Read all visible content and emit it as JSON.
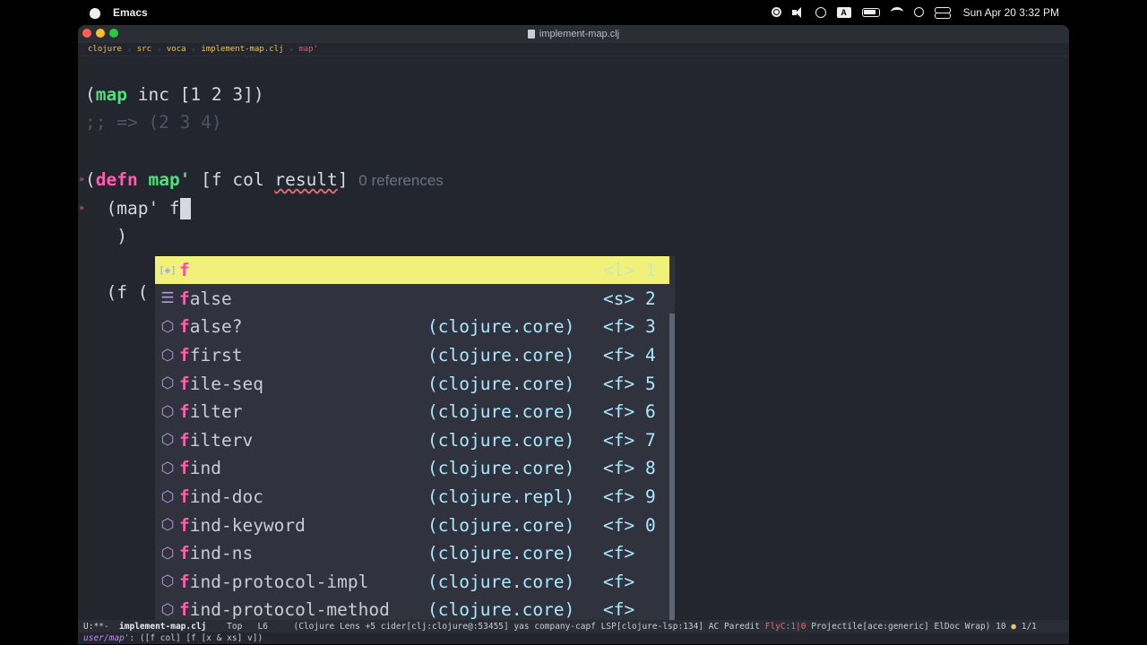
{
  "menubar": {
    "app_name": "Emacs",
    "keyboard_label": "A",
    "clock": "Sun Apr 20  3:32 PM"
  },
  "window": {
    "title": "implement-map.clj"
  },
  "breadcrumb": {
    "segments": [
      "clojure",
      "src",
      "voca",
      "implement-map.clj"
    ],
    "symbol": "map'"
  },
  "code": {
    "line1": {
      "open": "(",
      "fn": "map",
      "rest": " inc [1 2 3])"
    },
    "line2": ";; => (2 3 4)",
    "line3": {
      "open": "(",
      "kw": "defn",
      "name": " map'",
      "args_open": " [f col ",
      "warn_arg": "result",
      "args_close": "]",
      "refs": "0 references"
    },
    "line4": "  (map' f",
    "line5": "   )",
    "line6": "  (f ("
  },
  "completion": {
    "prefix": "f",
    "items": [
      {
        "rest": "",
        "kind": "var-icon",
        "ns": "",
        "annot": "<l> 1"
      },
      {
        "rest": "alse",
        "kind": "keyword-icon",
        "ns": "",
        "annot": "<s> 2"
      },
      {
        "rest": "alse?",
        "kind": "function-icon",
        "ns": "(clojure.core)",
        "annot": "<f> 3"
      },
      {
        "rest": "first",
        "kind": "function-icon",
        "ns": "(clojure.core)",
        "annot": "<f> 4"
      },
      {
        "rest": "ile-seq",
        "kind": "function-icon",
        "ns": "(clojure.core)",
        "annot": "<f> 5"
      },
      {
        "rest": "ilter",
        "kind": "function-icon",
        "ns": "(clojure.core)",
        "annot": "<f> 6"
      },
      {
        "rest": "ilterv",
        "kind": "function-icon",
        "ns": "(clojure.core)",
        "annot": "<f> 7"
      },
      {
        "rest": "ind",
        "kind": "function-icon",
        "ns": "(clojure.core)",
        "annot": "<f> 8"
      },
      {
        "rest": "ind-doc",
        "kind": "function-icon",
        "ns": "(clojure.repl)",
        "annot": "<f> 9"
      },
      {
        "rest": "ind-keyword",
        "kind": "function-icon",
        "ns": "(clojure.core)",
        "annot": "<f> 0"
      },
      {
        "rest": "ind-ns",
        "kind": "function-icon",
        "ns": "(clojure.core)",
        "annot": "<f>"
      },
      {
        "rest": "ind-protocol-impl",
        "kind": "function-icon",
        "ns": "(clojure.core)",
        "annot": "<f>"
      },
      {
        "rest": "ind-protocol-method",
        "kind": "function-icon",
        "ns": "(clojure.core)",
        "annot": "<f>"
      }
    ]
  },
  "modeline": {
    "state": "U:**-  ",
    "buffer": "implement-map.clj",
    "pos": "    Top   L6     ",
    "modes": "(Clojure Lens +5 cider[clj:clojure@:53455] yas company-capf LSP[clojure-lsp:134] AC Paredit ",
    "flycheck": "FlyC:1|0",
    "modes2": " Projectile[ace:generic] ElDoc Wrap) 10 ",
    "page": " 1/1"
  },
  "echo": {
    "symbol": "user/map'",
    "text": ": ([f col] [f [x & xs] v])"
  }
}
